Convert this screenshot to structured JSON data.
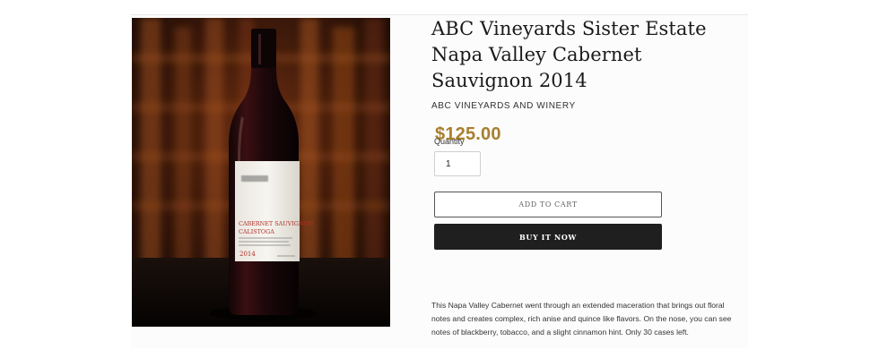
{
  "product": {
    "title": "ABC Vineyards Sister Estate Napa Valley Cabernet Sauvignon 2014",
    "vendor": "ABC VINEYARDS AND WINERY",
    "price": "$125.00",
    "quantity_label": "Quantity",
    "quantity_value": "1",
    "add_to_cart_label": "ADD TO CART",
    "buy_now_label": "BUY IT NOW",
    "description": "This Napa Valley Cabernet went through an extended maceration that brings out floral notes and creates complex, rich anise and quince like flavors. On the nose, you can see notes of blackberry, tobacco, and a slight cinnamon hint. Only 30 cases left.",
    "image": {
      "bottle_label_line1": "CABERNET SAUVIGNON",
      "bottle_label_line2": "CALISTOGA",
      "bottle_label_year": "2014"
    }
  },
  "colors": {
    "price": "#a87f2d",
    "buy_button": "#1f1f1f",
    "wine_label_accent": "#b0302a"
  }
}
